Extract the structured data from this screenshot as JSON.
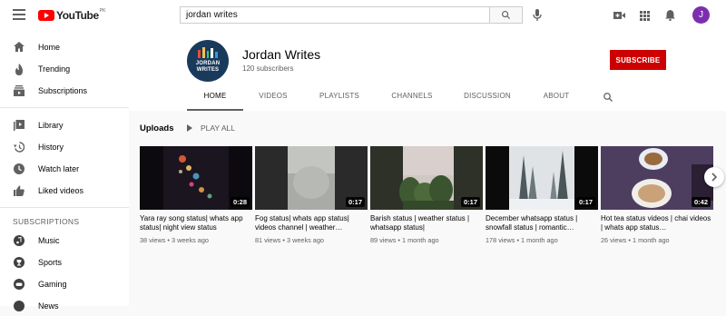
{
  "header": {
    "logo_text": "YouTube",
    "logo_region": "PK",
    "search_value": "jordan writes",
    "avatar_letter": "J"
  },
  "sidebar": {
    "main_items": [
      {
        "label": "Home",
        "icon": "home-icon"
      },
      {
        "label": "Trending",
        "icon": "trending-icon"
      },
      {
        "label": "Subscriptions",
        "icon": "subscriptions-icon"
      }
    ],
    "library_items": [
      {
        "label": "Library",
        "icon": "library-icon"
      },
      {
        "label": "History",
        "icon": "history-icon"
      },
      {
        "label": "Watch later",
        "icon": "watch-later-icon"
      },
      {
        "label": "Liked videos",
        "icon": "thumbs-up-icon"
      }
    ],
    "subscriptions_title": "SUBSCRIPTIONS",
    "subscription_items": [
      {
        "label": "Music",
        "icon": "music-icon"
      },
      {
        "label": "Sports",
        "icon": "trophy-icon"
      },
      {
        "label": "Gaming",
        "icon": "gaming-icon"
      },
      {
        "label": "News",
        "icon": "news-icon"
      }
    ]
  },
  "channel": {
    "avatar_text_1": "JORDAN",
    "avatar_text_2": "WRITES",
    "name": "Jordan Writes",
    "subscribers": "120 subscribers",
    "subscribe_label": "SUBSCRIBE",
    "tabs": [
      "HOME",
      "VIDEOS",
      "PLAYLISTS",
      "CHANNELS",
      "DISCUSSION",
      "ABOUT"
    ],
    "active_tab": "HOME"
  },
  "uploads": {
    "title": "Uploads",
    "play_all_label": "PLAY ALL",
    "videos": [
      {
        "title": "Yara ray song status| whats app status| night view status",
        "meta": "38 views • 3 weeks ago",
        "duration": "0:28"
      },
      {
        "title": "Fog status| whats app status| videos channel | weather…",
        "meta": "81 views • 3 weeks ago",
        "duration": "0:17"
      },
      {
        "title": "Barish status | weather status | whatsapp status|",
        "meta": "89 views • 1 month ago",
        "duration": "0:17"
      },
      {
        "title": "December whatsapp status | snowfall status | romantic…",
        "meta": "178 views • 1 month ago",
        "duration": "0:17"
      },
      {
        "title": "Hot tea status videos | chai videos | whats app status…",
        "meta": "26 views • 1 month ago",
        "duration": "0:42"
      }
    ]
  },
  "colors": {
    "brand_red": "#ff0000",
    "subscribe_red": "#cc0000",
    "avatar_purple": "#7b2fb0",
    "channel_avatar_bg": "#1a3a5c"
  }
}
